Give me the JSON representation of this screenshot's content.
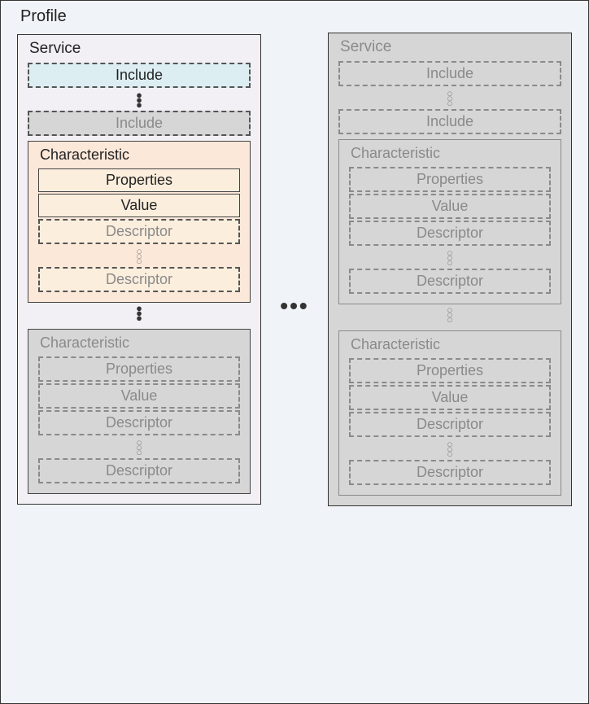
{
  "profile": {
    "title": "Profile"
  },
  "service": {
    "title": "Service"
  },
  "include": "Include",
  "characteristic": {
    "title": "Characteristic",
    "properties": "Properties",
    "value": "Value",
    "descriptor": "Descriptor"
  },
  "ellipsis": "•••"
}
